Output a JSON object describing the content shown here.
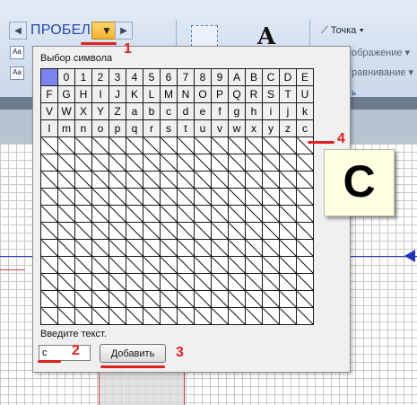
{
  "ribbon": {
    "point_label": "Точка",
    "display_label": "ображение",
    "align_label": "равнивание",
    "group_tail": "ь"
  },
  "font_nav": {
    "prev_symbol": "◀",
    "current_font": "ПРОБЕЛ",
    "dropdown_symbol": "▼",
    "next_symbol": "▶"
  },
  "dialog": {
    "title": "Выбор символа",
    "grid": {
      "columns": 16,
      "empty_rows": 11,
      "rows": [
        [
          "",
          "0",
          "1",
          "2",
          "3",
          "4",
          "5",
          "6",
          "7",
          "8",
          "9",
          "A",
          "B",
          "C",
          "D",
          "E"
        ],
        [
          "F",
          "G",
          "H",
          "I",
          "J",
          "K",
          "L",
          "M",
          "N",
          "O",
          "P",
          "Q",
          "R",
          "S",
          "T",
          "U"
        ],
        [
          "V",
          "W",
          "X",
          "Y",
          "Z",
          "a",
          "b",
          "c",
          "d",
          "e",
          "f",
          "g",
          "h",
          "i",
          "j",
          "k"
        ],
        [
          "l",
          "m",
          "n",
          "o",
          "p",
          "q",
          "r",
          "s",
          "t",
          "u",
          "v",
          "w",
          "x",
          "y",
          "z",
          "c"
        ]
      ]
    },
    "input_label": "Введите текст.",
    "input_value": "c",
    "add_button": "Добавить"
  },
  "preview": {
    "char": "C"
  },
  "annotations": [
    "1",
    "2",
    "3",
    "4"
  ],
  "colors": {
    "selected_cell": "#7e84ef",
    "annotation": "#e02020",
    "dropdown": "#f5b22d"
  }
}
